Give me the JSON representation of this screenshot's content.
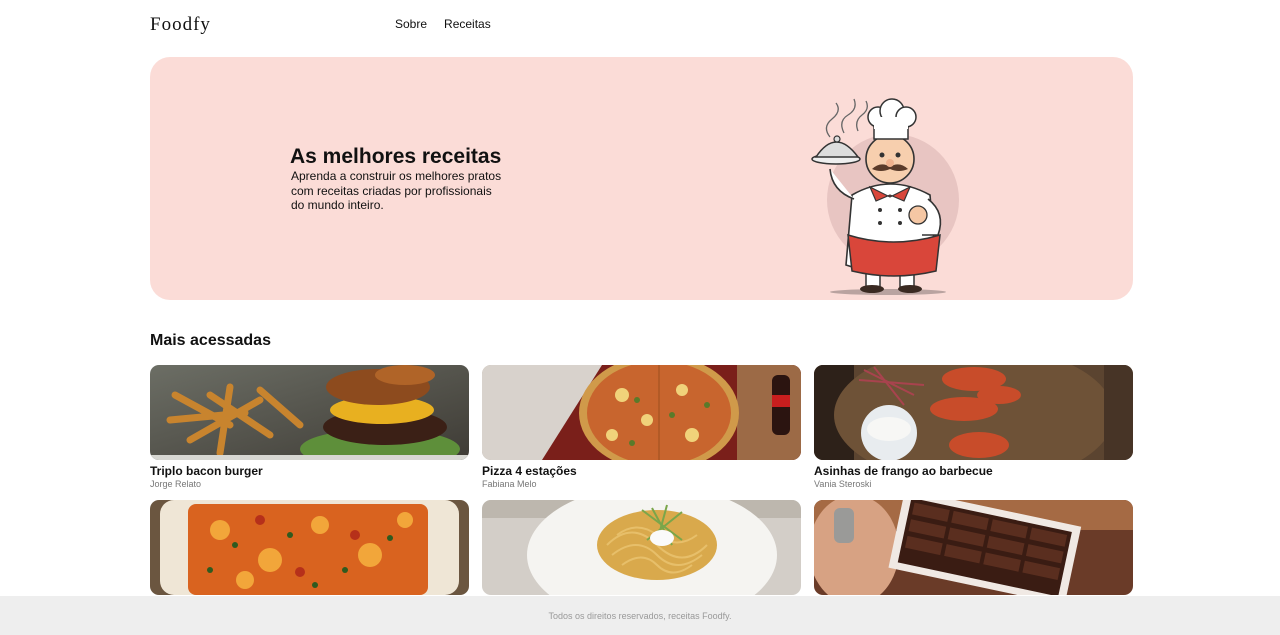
{
  "header": {
    "logo": "Foodfy",
    "nav": [
      {
        "label": "Sobre"
      },
      {
        "label": "Receitas"
      }
    ]
  },
  "hero": {
    "title": "As melhores receitas",
    "text": "Aprenda a construir os melhores pratos com receitas criadas por profissionais do mundo inteiro.",
    "illustration": "chef-illustration"
  },
  "section": {
    "title": "Mais acessadas"
  },
  "recipes": [
    {
      "title": "Triplo bacon burger",
      "author": "Jorge Relato",
      "image": "burger-photo"
    },
    {
      "title": "Pizza 4 estações",
      "author": "Fabiana Melo",
      "image": "pizza-photo"
    },
    {
      "title": "Asinhas de frango ao barbecue",
      "author": "Vania Steroski",
      "image": "chicken-wings-photo"
    },
    {
      "title": "",
      "author": "",
      "image": "lasagna-photo"
    },
    {
      "title": "",
      "author": "",
      "image": "spaghetti-photo"
    },
    {
      "title": "",
      "author": "",
      "image": "chocolates-photo"
    }
  ],
  "footer": {
    "text": "Todos os direitos reservados, receitas Foodfy."
  }
}
